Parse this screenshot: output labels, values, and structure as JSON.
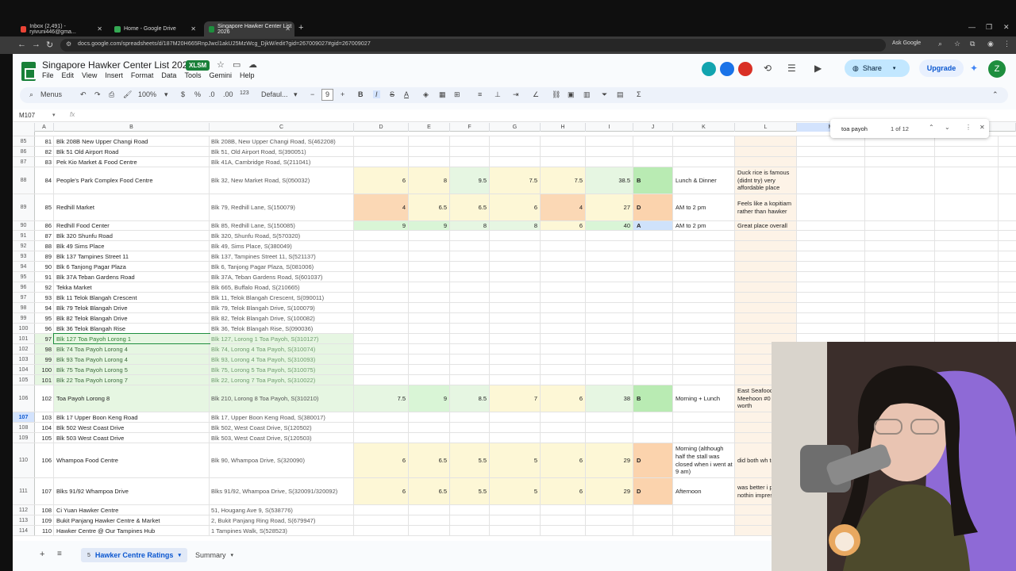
{
  "browser": {
    "tabs": [
      {
        "label": "Inbox (2,491) - ryivuni446@gma...",
        "icon_color": "#ea4335"
      },
      {
        "label": "Home - Google Drive",
        "icon_color": "#34a853"
      },
      {
        "label": "Singapore Hawker Center List 2026",
        "icon_color": "#1e8e3e"
      }
    ],
    "url": "docs.google.com/spreadsheets/d/187M20H665RnpJwcl1akU25MzWcg_DjkW/edit?gid=267009027#gid=267009027",
    "ask_google": "Ask Google"
  },
  "sheet": {
    "title": "Singapore Hawker Center List 2026",
    "badge": "XLSM",
    "menu": [
      "File",
      "Edit",
      "View",
      "Insert",
      "Format",
      "Data",
      "Tools",
      "Gemini",
      "Help"
    ],
    "share": "Share",
    "upgrade": "Upgrade",
    "avatar": "Z",
    "toolbar": {
      "menus": "Menus",
      "zoom": "100%",
      "currency": "$",
      "percent": "%",
      "dec_minus": ".0",
      "dec_plus": ".00",
      "num": "123",
      "font": "Defaul...",
      "font_size": "9"
    },
    "cell_ref": "M107",
    "fx": "fx",
    "columns": [
      "A",
      "B",
      "C",
      "D",
      "E",
      "F",
      "G",
      "H",
      "I",
      "J",
      "K",
      "L",
      "M"
    ],
    "find": {
      "query": "toa payoh",
      "count": "1 of 12"
    },
    "sheet_tabs": [
      {
        "label": "Hawker Centre Ratings",
        "count": "5"
      },
      {
        "label": "Summary"
      }
    ]
  },
  "rows": [
    {
      "rn": "85",
      "a": "81",
      "b": "Blk 208B New Upper Changi Road",
      "c": "Blk 208B, New Upper Changi Road, S(462208)"
    },
    {
      "rn": "86",
      "a": "82",
      "b": "Blk 51 Old Airport Road",
      "c": "Blk 51, Old Airport Road, S(390051)"
    },
    {
      "rn": "87",
      "a": "83",
      "b": "Pek Kio Market & Food Centre",
      "c": "Blk 41A, Cambridge Road, S(211041)"
    },
    {
      "rn": "88",
      "a": "84",
      "b": "People's Park Complex Food Centre",
      "c": "Blk 32, New Market Road, S(050032)",
      "d": "6",
      "e": "8",
      "f": "9.5",
      "g": "7.5",
      "h": "7.5",
      "i": "38.5",
      "j": "B",
      "k": "Lunch & Dinner",
      "l": "Duck rice is famous (didnt try) very affordable place"
    },
    {
      "rn": "89",
      "a": "85",
      "b": "Redhill Market",
      "c": "Blk 79, Redhill Lane, S(150079)",
      "d": "4",
      "e": "6.5",
      "f": "6.5",
      "g": "6",
      "h": "4",
      "i": "27",
      "j": "D",
      "k": "AM to 2 pm",
      "l": "Feels like a kopitiam rather than hawker"
    },
    {
      "rn": "90",
      "a": "86",
      "b": "Redhill Food Center",
      "c": "Blk 85, Redhill Lane, S(150085)",
      "d": "9",
      "e": "9",
      "f": "8",
      "g": "8",
      "h": "6",
      "i": "40",
      "j": "A",
      "k": "AM to 2 pm",
      "l": "Great place overall"
    },
    {
      "rn": "91",
      "a": "87",
      "b": "Blk 320 Shunfu Road",
      "c": "Blk 320, Shunfu Road, S(570320)"
    },
    {
      "rn": "92",
      "a": "88",
      "b": "Blk 49 Sims Place",
      "c": "Blk 49, Sims Place, S(380049)"
    },
    {
      "rn": "93",
      "a": "89",
      "b": "Blk 137 Tampines Street 11",
      "c": "Blk 137, Tampines Street 11, S(521137)"
    },
    {
      "rn": "94",
      "a": "90",
      "b": "Blk 6 Tanjong Pagar Plaza",
      "c": "Blk 6, Tanjong Pagar Plaza, S(081006)"
    },
    {
      "rn": "95",
      "a": "91",
      "b": "Blk 37A Teban Gardens Road",
      "c": "Blk 37A, Teban Gardens Road, S(601037)"
    },
    {
      "rn": "96",
      "a": "92",
      "b": "Tekka Market",
      "c": "Blk 665, Buffalo Road, S(210665)"
    },
    {
      "rn": "97",
      "a": "93",
      "b": "Blk 11 Telok Blangah Crescent",
      "c": "Blk 11, Telok Blangah Crescent, S(090011)"
    },
    {
      "rn": "98",
      "a": "94",
      "b": "Blk 79 Telok Blangah Drive",
      "c": "Blk 79, Telok Blangah Drive, S(100079)"
    },
    {
      "rn": "99",
      "a": "95",
      "b": "Blk 82 Telok Blangah Drive",
      "c": "Blk 82, Telok Blangah Drive, S(100082)"
    },
    {
      "rn": "100",
      "a": "96",
      "b": "Blk 36 Telok Blangah Rise",
      "c": "Blk 36, Telok Blangah Rise, S(090036)"
    },
    {
      "rn": "101",
      "a": "97",
      "b": "Blk 127 Toa Payoh Lorong 1",
      "c": "Blk 127, Lorong 1 Toa Payoh, S(310127)"
    },
    {
      "rn": "102",
      "a": "98",
      "b": "Blk 74 Toa Payoh Lorong 4",
      "c": "Blk 74, Lorong 4 Toa Payoh, S(310074)"
    },
    {
      "rn": "103",
      "a": "99",
      "b": "Blk 93 Toa Payoh Lorong 4",
      "c": "Blk 93, Lorong 4 Toa Payoh, S(310093)"
    },
    {
      "rn": "104",
      "a": "100",
      "b": "Blk 75 Toa Payoh Lorong 5",
      "c": "Blk 75, Lorong 5 Toa Payoh, S(310075)"
    },
    {
      "rn": "105",
      "a": "101",
      "b": "Blk 22 Toa Payoh Lorong 7",
      "c": "Blk 22, Lorong 7 Toa Payoh, S(310022)"
    },
    {
      "rn": "106",
      "a": "102",
      "b": "Toa Payoh Lorong 8",
      "c": "Blk 210, Lorong 8 Toa Payoh, S(310210)",
      "d": "7.5",
      "e": "9",
      "f": "8.5",
      "g": "7",
      "h": "6",
      "i": "38",
      "j": "B",
      "k": "Morning + Lunch",
      "l": "East Seafood Meehoon #0 stall is worth"
    },
    {
      "rn": "107",
      "a": "103",
      "b": "Blk 17 Upper Boon Keng Road",
      "c": "Blk 17, Upper Boon Keng Road, S(380017)"
    },
    {
      "rn": "108",
      "a": "104",
      "b": "Blk 502 West Coast Drive",
      "c": "Blk 502, West Coast Drive, S(120502)"
    },
    {
      "rn": "109",
      "a": "105",
      "b": "Blk 503 West Coast Drive",
      "c": "Blk 503, West Coast Drive, S(120503)"
    },
    {
      "rn": "110",
      "a": "106",
      "b": "Whampoa Food Centre",
      "c": "Blk 90, Whampoa Drive, S(320090)",
      "d": "6",
      "e": "6.5",
      "f": "5.5",
      "g": "5",
      "h": "6",
      "i": "29",
      "j": "D",
      "k": "Morning (although half the stall was closed when i went at 9 am)",
      "l": "did both wh together"
    },
    {
      "rn": "111",
      "a": "107",
      "b": "Blks 91/92 Whampoa Drive",
      "c": "Blks 91/92, Whampoa Drive, S(320091/320092)",
      "d": "6",
      "e": "6.5",
      "f": "5.5",
      "g": "5",
      "h": "6",
      "i": "29",
      "j": "D",
      "k": "Afternoon",
      "l": "was better i past, nothin impressed n"
    },
    {
      "rn": "112",
      "a": "108",
      "b": "Ci Yuan Hawker Centre",
      "c": "51, Hougang Ave 9, S(538776)"
    },
    {
      "rn": "113",
      "a": "109",
      "b": "Bukit Panjang Hawker Centre & Market",
      "c": "2, Bukit Panjang Ring Road, S(679947)"
    },
    {
      "rn": "114",
      "a": "110",
      "b": "Hawker Centre @ Our Tampines Hub",
      "c": "1 Tampines Walk, S(528523)"
    }
  ],
  "colors": {
    "green_header": "#188038",
    "selection": "#d3e3fd",
    "accent": "#0b57d0"
  }
}
